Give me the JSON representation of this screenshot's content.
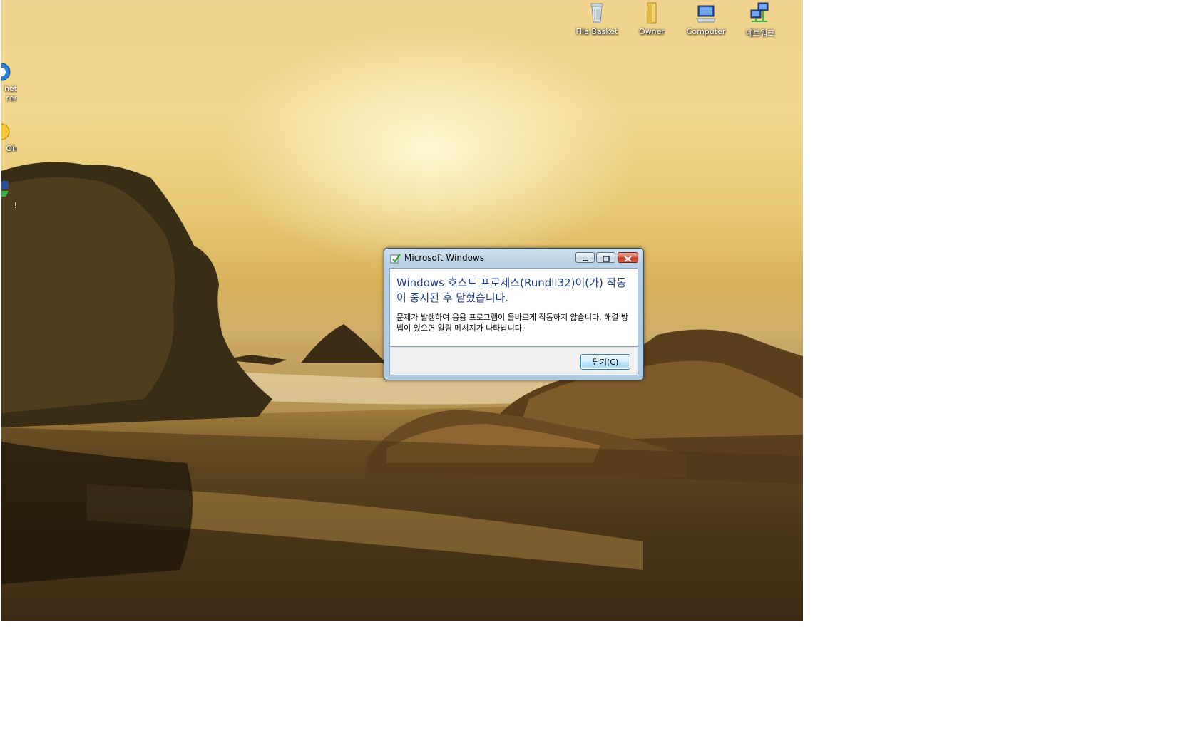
{
  "desktop": {
    "icons": [
      {
        "label": "File Basket",
        "icon": "recycle-bin-icon"
      },
      {
        "label": "Owner",
        "icon": "user-folder-icon"
      },
      {
        "label": "Computer",
        "icon": "computer-icon"
      },
      {
        "label": "네트워크",
        "icon": "network-icon"
      }
    ],
    "left_icons": [
      {
        "label": "net\nrer",
        "icon": "internet-explorer-icon"
      },
      {
        "label": "On",
        "icon": "messenger-icon"
      },
      {
        "label": "!",
        "icon": "app-icon"
      }
    ]
  },
  "dialog": {
    "title": "Microsoft Windows",
    "main_instruction": "Windows 호스트 프로세스(Rundll32)이(가) 작동이 중지된 후 닫혔습니다.",
    "body": "문제가 발생하여 응용 프로그램이 올바르게 작동하지 않습니다. 해결 방법이 있으면 알림 메시지가 나타납니다.",
    "close_button": "닫기(C)",
    "colors": {
      "title_accent": "#1f3f94",
      "close_red": "#c0351e"
    }
  }
}
